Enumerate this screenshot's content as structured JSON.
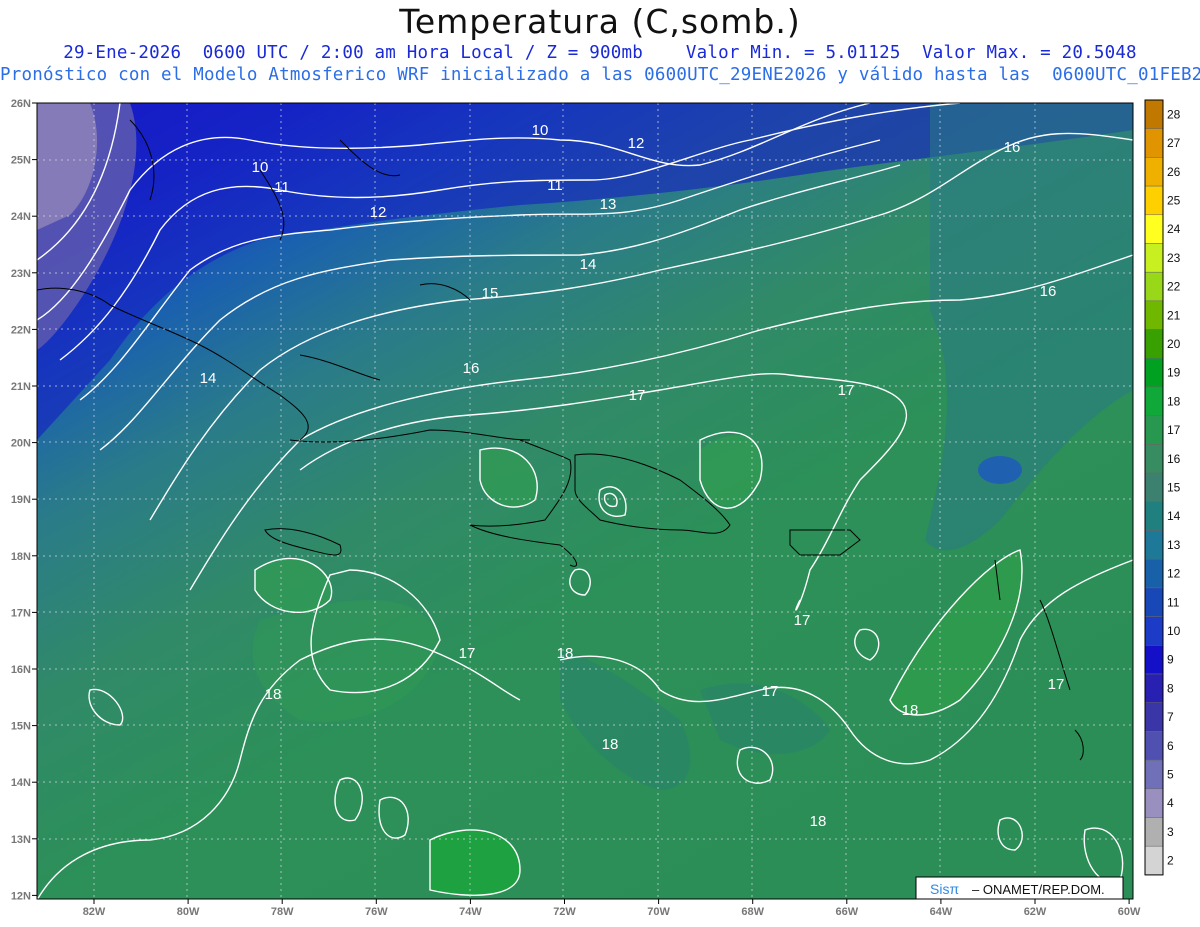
{
  "header": {
    "title": "Temperatura (C,somb.)",
    "line1": "29-Ene-2026  0600 UTC / 2:00 am Hora Local / Z = 900mb    Valor Min. = 5.01125  Valor Max. = 20.5048",
    "line2": "Pronóstico con el Modelo Atmosferico WRF inicializado a las 0600UTC_29ENE2026 y válido hasta las  0600UTC_01FEB2026"
  },
  "map": {
    "lat_labels": [
      "26N",
      "25N",
      "24N",
      "23N",
      "22N",
      "21N",
      "20N",
      "19N",
      "18N",
      "17N",
      "16N",
      "15N",
      "14N",
      "13N",
      "12N"
    ],
    "lon_labels": [
      "82W",
      "80W",
      "78W",
      "76W",
      "74W",
      "72W",
      "70W",
      "68W",
      "66W",
      "64W",
      "62W",
      "60W"
    ],
    "contour_labels": [
      "10",
      "12",
      "16",
      "10",
      "11",
      "11",
      "13",
      "12",
      "14",
      "15",
      "16",
      "16",
      "14",
      "17",
      "17",
      "17",
      "18",
      "17",
      "17",
      "18",
      "18",
      "18",
      "17",
      "18"
    ]
  },
  "colorbar": {
    "levels": [
      "28",
      "27",
      "26",
      "25",
      "24",
      "23",
      "22",
      "21",
      "20",
      "19",
      "18",
      "17",
      "16",
      "15",
      "14",
      "13",
      "12",
      "11",
      "10",
      "9",
      "8",
      "7",
      "6",
      "5",
      "4",
      "3",
      "2"
    ],
    "colors": [
      "#c07800",
      "#e09400",
      "#f0b000",
      "#ffd000",
      "#ffff20",
      "#c8f020",
      "#98d818",
      "#70b800",
      "#38a000",
      "#00a020",
      "#10a838",
      "#289850",
      "#388c62",
      "#3c8070",
      "#208080",
      "#1e7898",
      "#1860a8",
      "#1848b8",
      "#1c3cc8",
      "#1410c8",
      "#2820b0",
      "#3a36a8",
      "#5050b0",
      "#7070b8",
      "#9a90c0",
      "#b0b0b0",
      "#d4d4d4"
    ]
  },
  "credit": {
    "logo": "Sisπ",
    "text": "– ONAMET/REP.DOM."
  }
}
